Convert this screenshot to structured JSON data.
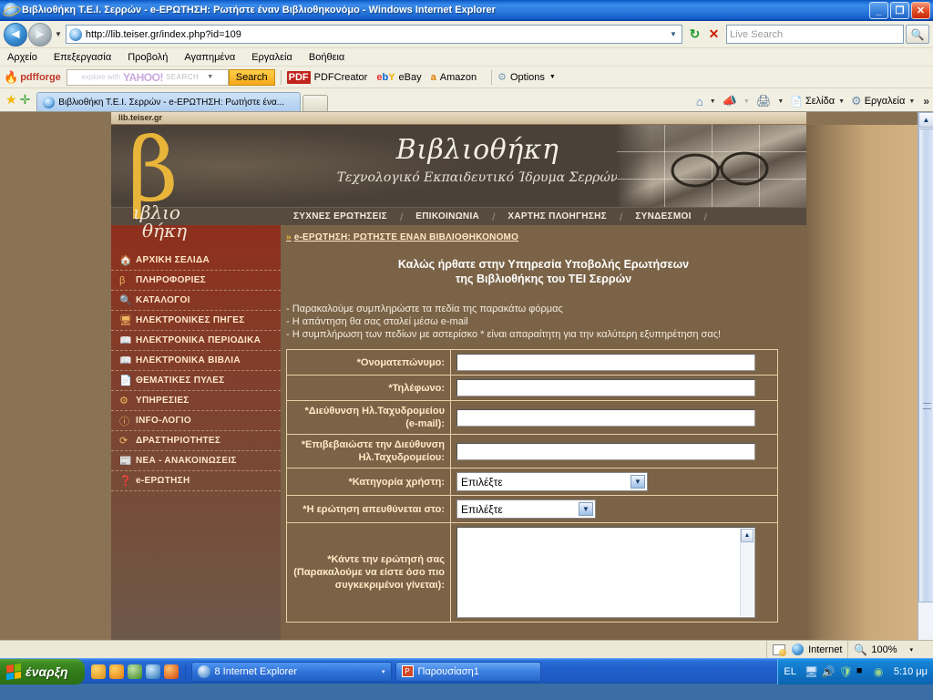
{
  "window": {
    "title": "Βιβλιοθήκη Τ.Ε.Ι. Σερρών - e-ΕΡΩΤΗΣΗ: Ρωτήστε έναν Βιβλιοθηκονόμο - Windows Internet Explorer",
    "minimize_label": "_",
    "maximize_label": "❐",
    "close_label": "✕"
  },
  "address_bar": {
    "url": "http://lib.teiser.gr/index.php?id=109",
    "back_label": "◄",
    "forward_label": "►",
    "refresh_label": "↻",
    "stop_label": "✕",
    "search_placeholder": "Live Search",
    "search_go_label": "🔍"
  },
  "menu": {
    "items": [
      "Αρχείο",
      "Επεξεργασία",
      "Προβολή",
      "Αγαπημένα",
      "Εργαλεία",
      "Βοήθεια"
    ]
  },
  "pdfforge_toolbar": {
    "brand": "pdfforge",
    "yahoo_explore": "explore with",
    "yahoo_logo": "YAHOO!",
    "yahoo_search_word": "SEARCH",
    "search_button": "Search",
    "items": [
      {
        "label": "PDFCreator",
        "icon": "pdf-icon"
      },
      {
        "label": "eBay",
        "icon": "ebay-icon"
      },
      {
        "label": "Amazon",
        "icon": "amazon-icon"
      },
      {
        "label": "Options",
        "icon": "gear-icon"
      }
    ]
  },
  "tab_bar": {
    "favorites_icon": "★",
    "add_favorite_icon": "✛",
    "tab_title": "Βιβλιοθήκη Τ.Ε.Ι. Σερρών - e-ΕΡΩΤΗΣΗ: Ρωτήστε ένα...",
    "tools": [
      {
        "label": "",
        "icon": "home-icon"
      },
      {
        "label": "",
        "icon": "feeds-icon"
      },
      {
        "label": "",
        "icon": "print-icon"
      },
      {
        "label": "Σελίδα",
        "icon": "page-icon"
      },
      {
        "label": "Εργαλεία",
        "icon": "gear-icon"
      }
    ],
    "more_label": "»"
  },
  "page": {
    "url_strip": "lib.teiser.gr",
    "banner": {
      "title": "Βιβλιοθήκη",
      "subtitle": "Τεχνολογικό Εκπαιδευτικό Ίδρυμα Σερρών"
    },
    "logo": {
      "symbol": "β",
      "text_line1": "ιβλιο",
      "text_line2": "θήκη"
    },
    "top_nav": [
      "ΣΥΧΝΕΣ ΕΡΩΤΗΣΕΙΣ",
      "ΕΠΙΚΟΙΝΩΝΙΑ",
      "ΧΑΡΤΗΣ ΠΛΟΗΓΗΣΗΣ",
      "ΣΥΝΔΕΣΜΟΙ"
    ],
    "sidebar": [
      {
        "label": "ΑΡΧΙΚΗ ΣΕΛΙΔΑ",
        "icon": "home-icon"
      },
      {
        "label": "ΠΛΗΡΟΦΟΡΙΕΣ",
        "icon": "beta-icon"
      },
      {
        "label": "ΚΑΤΑΛΟΓΟΙ",
        "icon": "search-icon"
      },
      {
        "label": "ΗΛΕΚΤΡΟΝΙΚΕΣ ΠΗΓΕΣ",
        "icon": "monitor-icon"
      },
      {
        "label": "ΗΛΕΚΤΡΟΝΙΚΑ ΠΕΡΙΟΔΙΚΑ",
        "icon": "book-icon"
      },
      {
        "label": "ΗΛΕΚΤΡΟΝΙΚΑ ΒΙΒΛΙΑ",
        "icon": "book-icon"
      },
      {
        "label": "ΘΕΜΑΤΙΚΕΣ ΠΥΛΕΣ",
        "icon": "document-icon"
      },
      {
        "label": "ΥΠΗΡΕΣΙΕΣ",
        "icon": "gears-icon"
      },
      {
        "label": "INFO-ΛΟΓΙΟ",
        "icon": "info-icon"
      },
      {
        "label": "ΔΡΑΣΤΗΡΙΟΤΗΤΕΣ",
        "icon": "activity-icon"
      },
      {
        "label": "ΝΕΑ - ΑΝΑΚΟΙΝΩΣΕΙΣ",
        "icon": "news-icon"
      },
      {
        "label": "e-ΕΡΩΤΗΣΗ",
        "icon": "question-icon"
      }
    ],
    "breadcrumb": "e-ΕΡΩΤΗΣΗ: ΡΩΤΗΣΤΕ ΕΝΑΝ ΒΙΒΛΙΟΘΗΚΟΝΟΜΟ",
    "breadcrumb_arrow": "»",
    "welcome_line1": "Καλώς ήρθατε στην Υπηρεσία Υποβολής Ερωτήσεων",
    "welcome_line2": "της Βιβλιοθήκης του ΤΕΙ Σερρών",
    "instructions": [
      "- Παρακαλούμε συμπληρώστε τα πεδία της παρακάτω φόρμας",
      "- Η απάντηση θα σας σταλεί μέσω e-mail",
      "- Η συμπλήρωση των πεδίων με αστερίσκο * είναι απαραίτητη για την καλύτερη εξυπηρέτηση σας!"
    ],
    "form": {
      "fields": [
        {
          "label": "*Ονοματεπώνυμο:",
          "type": "text",
          "value": ""
        },
        {
          "label": "*Τηλέφωνο:",
          "type": "text",
          "value": ""
        },
        {
          "label": "*Διεύθυνση Ηλ.Ταχυδρομείου (e-mail):",
          "type": "text",
          "value": ""
        },
        {
          "label": "*Επιβεβαιώστε την Διεύθυνση Ηλ.Ταχυδρομείου:",
          "type": "text",
          "value": ""
        },
        {
          "label": "*Κατηγορία χρήστη:",
          "type": "select",
          "value": "Επιλέξτε"
        },
        {
          "label": "*Η ερώτηση απευθύνεται στο:",
          "type": "select",
          "value": "Επιλέξτε"
        },
        {
          "label": "*Κάντε την ερώτησή σας (Παρακαλούμε να είστε όσο πιο συγκεκριμένοι γίνεται):",
          "type": "textarea",
          "value": ""
        }
      ]
    }
  },
  "status_bar": {
    "zone": "Internet",
    "zoom": "100%",
    "zoom_caret": "▾"
  },
  "taskbar": {
    "start_label": "έναρξη",
    "tasks": [
      {
        "label": "8 Internet Explorer",
        "icon": "ie-icon",
        "caret": "▾"
      },
      {
        "label": "Παρουσίαση1",
        "icon": "powerpoint-icon"
      }
    ],
    "language": "EL",
    "clock": "5:10 μμ"
  },
  "colors": {
    "title_bar": "#1560cc",
    "page_bg": "#8a7254",
    "content_bg": "#7b6347",
    "banner_bg": "#4a4138",
    "sidebar_top": "#8e2f1d",
    "accent_gold": "#e8b53a",
    "nav_bar": "#574b3f",
    "field_border": "#e7cfa8"
  }
}
